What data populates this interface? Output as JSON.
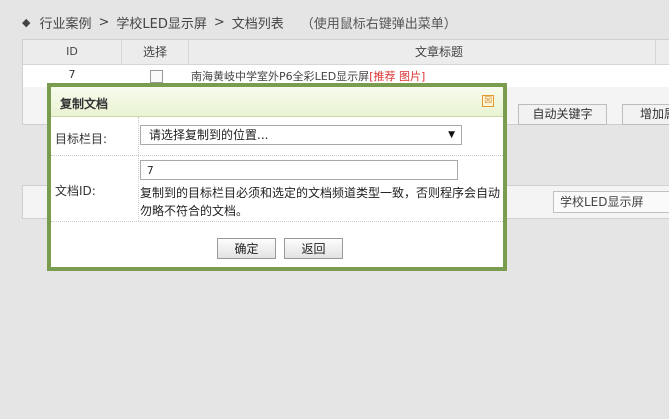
{
  "breadcrumb": {
    "items": [
      "行业案例",
      "学校LED显示屏",
      "文档列表"
    ],
    "hint": "（使用鼠标右键弹出菜单）",
    "separator": ">"
  },
  "table": {
    "headers": [
      "ID",
      "选择",
      "文章标题"
    ],
    "rows": [
      {
        "id": "7",
        "title": "南海黄岐中学室外P6全彩LED显示屏",
        "tags": "[推荐 图片]"
      }
    ]
  },
  "background_buttons": {
    "auto_keyword": "自动关键字",
    "add_attr": "增加属"
  },
  "background_select": {
    "value": "学校LED显示屏"
  },
  "dialog": {
    "title": "复制文档",
    "close_glyph": "☒",
    "target_label": "目标栏目:",
    "target_placeholder": "请选择复制到的位置...",
    "doc_id_label": "文档ID:",
    "doc_id_value": "7",
    "note": "复制到的目标栏目必须和选定的文档频道类型一致，否则程序会自动勿略不符合的文档。",
    "ok_label": "确定",
    "back_label": "返回"
  },
  "icons": {
    "dropdown_arrow": "▼"
  },
  "colors": {
    "dialog_border": "#7a9c4e",
    "title_bg": "#e9f3d3",
    "tag_red": "#d33333"
  }
}
